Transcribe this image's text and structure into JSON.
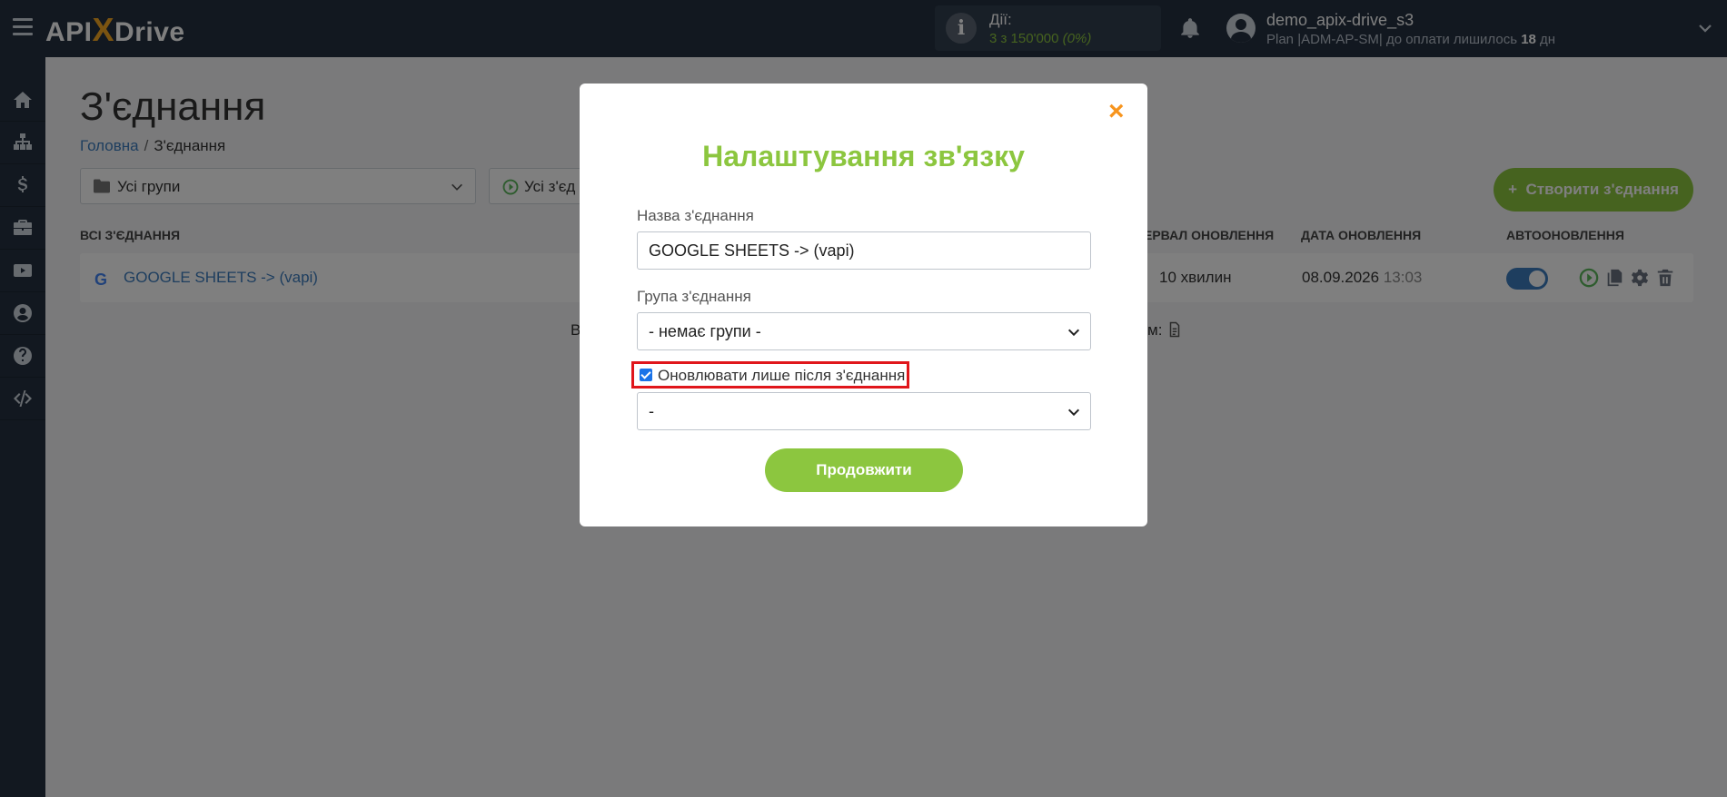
{
  "topbar": {
    "logo_api": "API",
    "logo_x": "X",
    "logo_drive": "Drive",
    "actions_label": "Дії:",
    "actions_value": "3 з 150'000",
    "actions_percent": "(0%)",
    "user_name": "demo_apix-drive_s3",
    "user_plan_prefix": "Plan |ADM-AP-SM| до оплати лишилось",
    "user_plan_days": "18",
    "user_plan_suffix": "дн"
  },
  "sidebar": {
    "items": [
      "home-icon",
      "sitemap-icon",
      "dollar-icon",
      "briefcase-icon",
      "youtube-icon",
      "user-circle-icon",
      "help-icon",
      "code-icon"
    ]
  },
  "page": {
    "title": "З'єднання",
    "breadcrumb_home": "Головна",
    "breadcrumb_sep": "/",
    "breadcrumb_current": "З'єднання",
    "groups_select": "Усі групи",
    "status_select": "Усі з'єд",
    "create_button": "Створити з'єднання",
    "create_plus": "+"
  },
  "table": {
    "headers": {
      "all": "ВСІ З'ЄДНАННЯ",
      "interval": "ЕРВАЛ ОНОВЛЕННЯ",
      "date": "ДАТА ОНОВЛЕННЯ",
      "auto": "АВТООНОВЛЕННЯ"
    },
    "row": {
      "g": "G",
      "name": "GOOGLE SHEETS -> (vapi)",
      "interval": "10 хвилин",
      "date": "08.09.2026",
      "time": "13:03",
      "autoupdate_on": true
    },
    "below_left": "В",
    "below_right": "м:"
  },
  "modal": {
    "close": "×",
    "title": "Налаштування зв'язку",
    "name_label": "Назва з'єднання",
    "name_value": "GOOGLE SHEETS -> (vapi)",
    "group_label": "Група з'єднання",
    "group_value": "- немає групи -",
    "checkbox_label": "Оновлювати лише після з'єднання",
    "checkbox_checked": true,
    "after_value": "-",
    "continue_button": "Продовжити"
  },
  "colors": {
    "topbar": "#243040",
    "accent_green": "#8cc63f",
    "link_blue": "#3d7dbf",
    "close_orange": "#f7941d",
    "highlight_red": "#e0161b"
  }
}
